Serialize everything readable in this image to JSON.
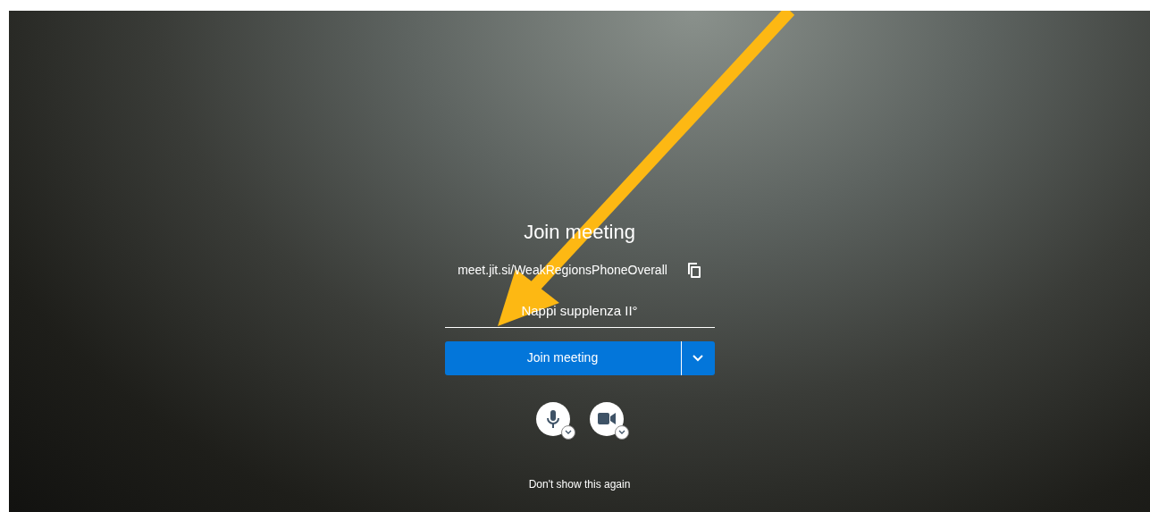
{
  "title": "Join meeting",
  "meeting_url": "meet.jit.si/WeakRegionsPhoneOverall",
  "name_field": {
    "value": "Nappi supplenza II°"
  },
  "join_button": {
    "label": "Join meeting"
  },
  "dont_show_again": "Don't show this again"
}
